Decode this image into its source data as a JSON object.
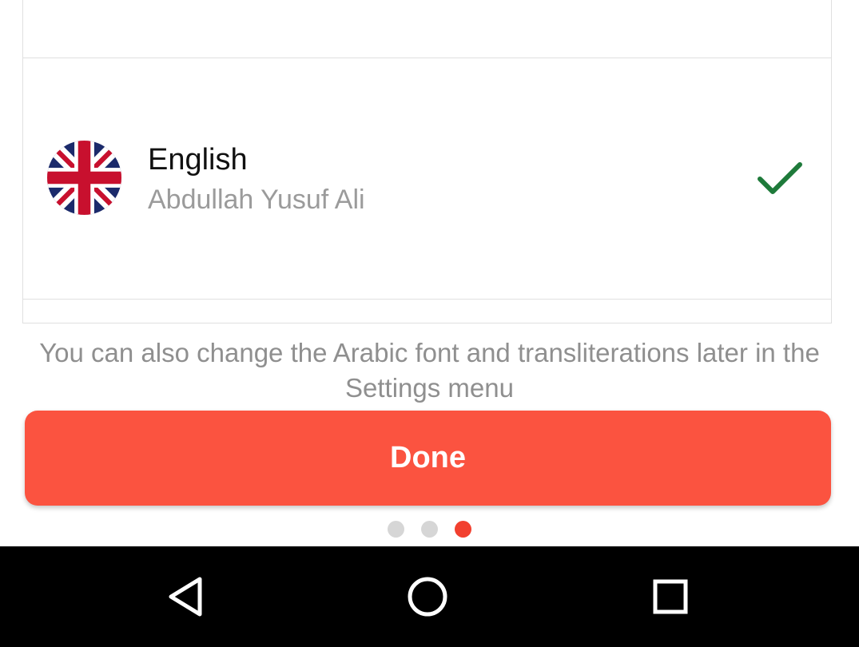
{
  "language_list": {
    "selected": {
      "language": "English",
      "translator": "Abdullah Yusuf Ali",
      "flag_icon": "uk-flag-icon",
      "selected_icon": "checkmark-icon",
      "check_color": "#1e7a3a"
    }
  },
  "hint_text": "You can also change the Arabic font and transliterations later in the Settings menu",
  "done_button": {
    "label": "Done",
    "color": "#fb5340"
  },
  "pager": {
    "total": 3,
    "current": 3,
    "active_color": "#f2402f"
  },
  "nav_bar": {
    "back_icon": "back-triangle-icon",
    "home_icon": "home-circle-icon",
    "recents_icon": "recents-square-icon"
  }
}
